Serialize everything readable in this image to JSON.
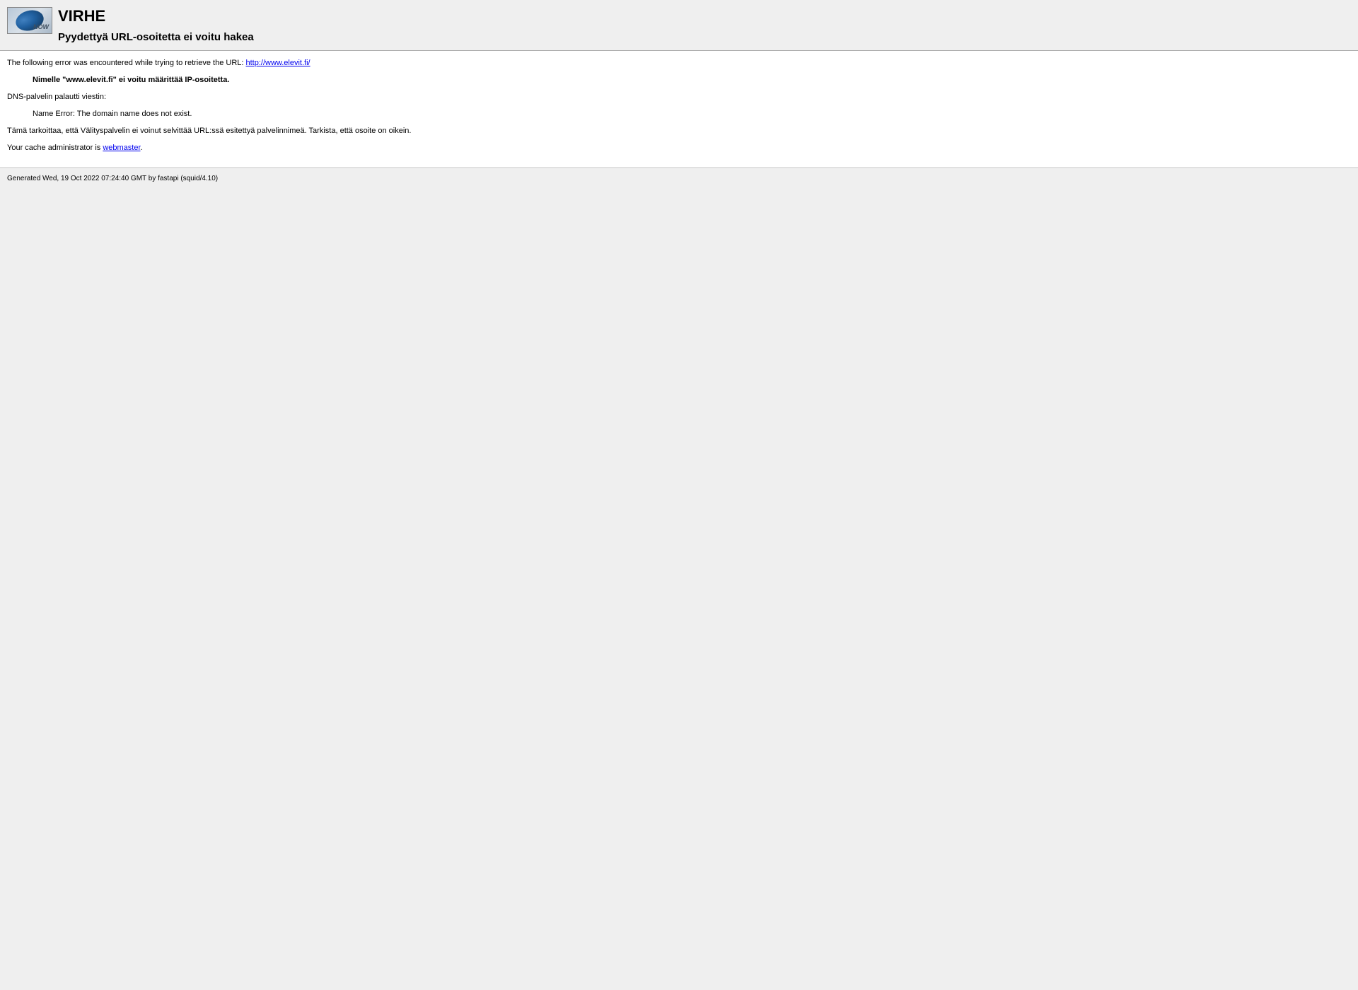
{
  "header": {
    "title": "VIRHE",
    "subtitle": "Pyydettyä URL-osoitetta ei voitu hakea"
  },
  "content": {
    "intro_prefix": "The following error was encountered while trying to retrieve the URL: ",
    "intro_url": "http://www.elevit.fi/",
    "error_bold": "Nimelle \"www.elevit.fi\" ei voitu määrittää IP-osoitetta.",
    "dns_line": "DNS-palvelin palautti viestin:",
    "dns_error": "Name Error: The domain name does not exist.",
    "explanation": "Tämä tarkoittaa, että Välityspalvelin ei voinut selvittää URL:ssä esitettyä palvelinnimeä. Tarkista, että osoite on oikein.",
    "admin_prefix": "Your cache administrator is ",
    "admin_link": "webmaster",
    "admin_suffix": "."
  },
  "footer": {
    "generated": "Generated Wed, 19 Oct 2022 07:24:40 GMT by fastapi (squid/4.10)"
  }
}
